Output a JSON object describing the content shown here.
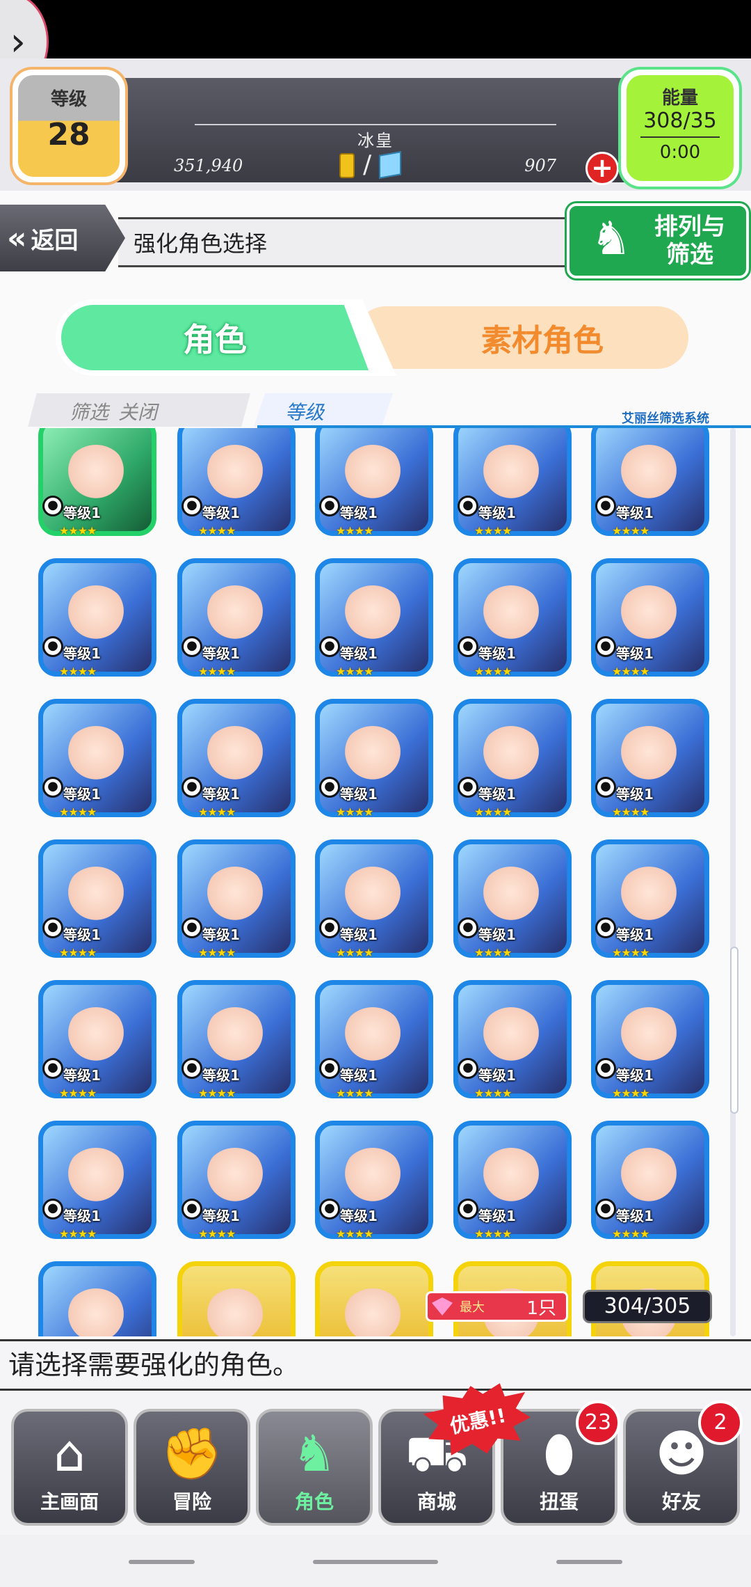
{
  "header": {
    "level_label": "等级",
    "level_value": "28",
    "rank_title": "冰皇",
    "gold": "351,940",
    "gems": "907",
    "energy_label": "能量",
    "energy_value": "308/35",
    "energy_timer": "0:00"
  },
  "title_row": {
    "back_label": "返回",
    "title": "强化角色选择",
    "sort_label": "排列与筛选"
  },
  "tabs": {
    "characters": "角色",
    "materials": "素材角色"
  },
  "filter": {
    "filter_label": "筛选",
    "close_label": "关闭",
    "level_label": "等级",
    "system_label": "艾丽丝筛选系统"
  },
  "cards": [
    {
      "frame": "green",
      "level": "等级1"
    },
    {
      "frame": "blue",
      "level": "等级1"
    },
    {
      "frame": "blue",
      "level": "等级1"
    },
    {
      "frame": "blue",
      "level": "等级1"
    },
    {
      "frame": "blue",
      "level": "等级1"
    },
    {
      "frame": "blue",
      "level": "等级1"
    },
    {
      "frame": "blue",
      "level": "等级1"
    },
    {
      "frame": "blue",
      "level": "等级1"
    },
    {
      "frame": "blue",
      "level": "等级1"
    },
    {
      "frame": "blue",
      "level": "等级1"
    },
    {
      "frame": "blue",
      "level": "等级1"
    },
    {
      "frame": "blue",
      "level": "等级1"
    },
    {
      "frame": "blue",
      "level": "等级1"
    },
    {
      "frame": "blue",
      "level": "等级1"
    },
    {
      "frame": "blue",
      "level": "等级1"
    },
    {
      "frame": "blue",
      "level": "等级1"
    },
    {
      "frame": "blue",
      "level": "等级1"
    },
    {
      "frame": "blue",
      "level": "等级1"
    },
    {
      "frame": "blue",
      "level": "等级1"
    },
    {
      "frame": "blue",
      "level": "等级1"
    },
    {
      "frame": "blue",
      "level": "等级1"
    },
    {
      "frame": "blue",
      "level": "等级1"
    },
    {
      "frame": "blue",
      "level": "等级1"
    },
    {
      "frame": "blue",
      "level": "等级1"
    },
    {
      "frame": "blue",
      "level": "等级1"
    },
    {
      "frame": "blue",
      "level": "等级1"
    },
    {
      "frame": "blue",
      "level": "等级1"
    },
    {
      "frame": "blue",
      "level": "等级1"
    },
    {
      "frame": "blue",
      "level": "等级1"
    },
    {
      "frame": "blue",
      "level": "等级1"
    },
    {
      "frame": "blue",
      "level": ""
    },
    {
      "frame": "yellow",
      "level": ""
    },
    {
      "frame": "yellow",
      "level": ""
    },
    {
      "frame": "yellow",
      "level": ""
    },
    {
      "frame": "yellow",
      "level": ""
    }
  ],
  "stars": "★★★★",
  "element_glyph": "💧",
  "max_badge": {
    "label": "最大",
    "value": "1只"
  },
  "count": "304/305",
  "message": "请选择需要强化的角色。",
  "nav": {
    "home": "主画面",
    "adventure": "冒险",
    "characters": "角色",
    "shop": "商城",
    "gacha": "扭蛋",
    "friends": "好友",
    "gacha_badge": "23",
    "friends_badge": "2",
    "sale_tag": "优惠!!"
  },
  "colors": {
    "card_blue": "#1e86e6",
    "card_green": "#23d168",
    "card_yellow": "#f5d30a",
    "accent_green": "#5ee8a0",
    "accent_orange": "#f28a2e"
  }
}
